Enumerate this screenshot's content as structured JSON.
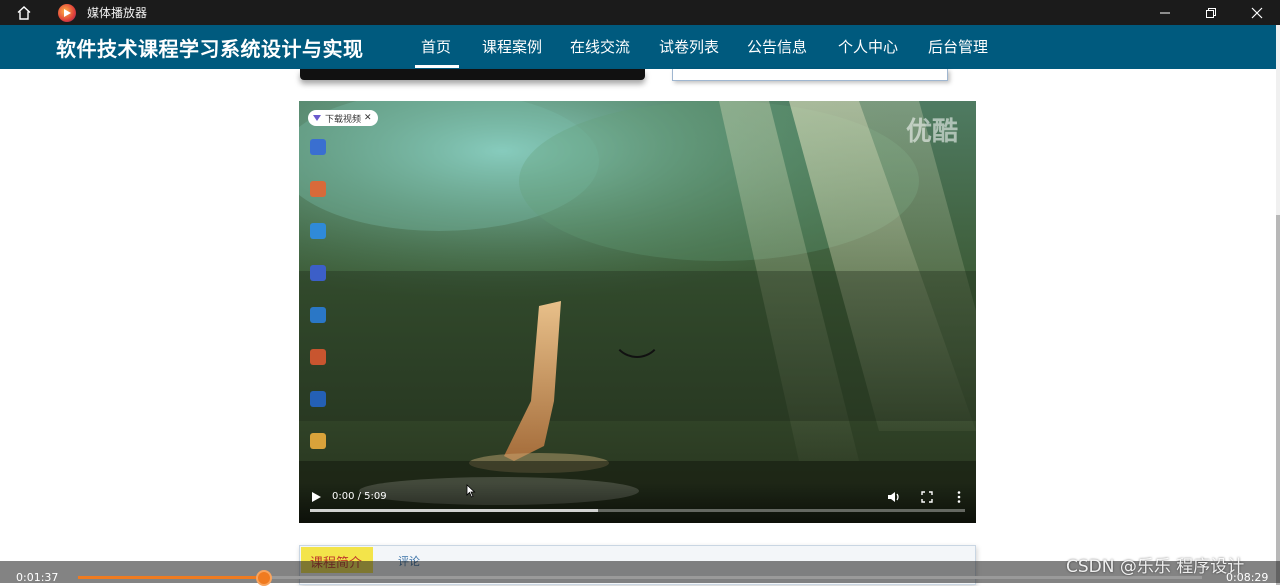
{
  "window": {
    "title": "媒体播放器",
    "icons": {
      "home": "home-icon",
      "app": "media-player-icon",
      "minimize": "minimize-icon",
      "maximize": "restore-icon",
      "close": "close-icon"
    }
  },
  "site": {
    "title": "软件技术课程学习系统设计与实现",
    "nav": [
      "首页",
      "课程案例",
      "在线交流",
      "试卷列表",
      "公告信息",
      "个人中心",
      "后台管理"
    ],
    "active_nav": "首页",
    "colors": {
      "navbar": "#005a7e",
      "accent": "#f07b20",
      "tab_active_bg": "#f3e44a",
      "tab_active_text": "#c0392b"
    }
  },
  "video": {
    "watermark": "优酷",
    "download_chip": "下载视频",
    "time": "0:00 / 5:09",
    "buffer_fraction": 0.44,
    "icons": [
      "play-icon",
      "volume-icon",
      "fullscreen-icon",
      "more-options-icon"
    ]
  },
  "tabs": {
    "active": "课程简介",
    "other": "评论"
  },
  "player": {
    "current_time": "0:01:37",
    "total_time": "0:08:29",
    "progress_fraction": 0.1656
  },
  "watermark": "CSDN @乐乐 程序设计"
}
